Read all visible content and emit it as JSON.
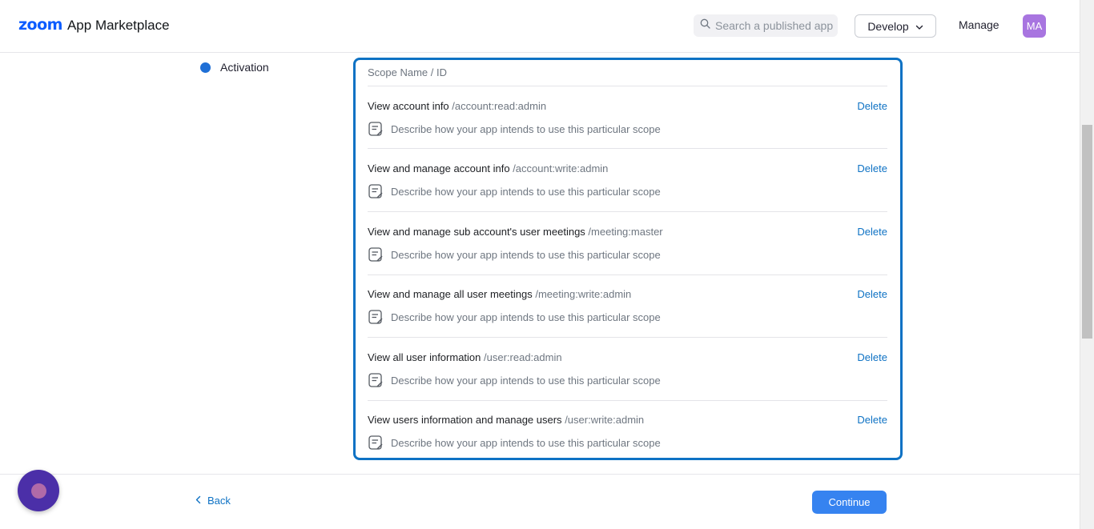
{
  "header": {
    "logo_brand": "zoom",
    "logo_text": "App Marketplace",
    "search_placeholder": "Search a published app",
    "develop_label": "Develop",
    "manage_label": "Manage",
    "avatar_initials": "MA"
  },
  "sidebar": {
    "items": [
      {
        "label": "Activation",
        "color": "#1f6fd6"
      }
    ]
  },
  "scopes": {
    "header": "Scope Name / ID",
    "delete_label": "Delete",
    "description_placeholder": "Describe how your app intends to use this particular scope",
    "items": [
      {
        "name": "View account info",
        "id": "/account:read:admin"
      },
      {
        "name": "View and manage account info",
        "id": "/account:write:admin"
      },
      {
        "name": "View and manage sub account's user meetings",
        "id": "/meeting:master"
      },
      {
        "name": "View and manage all user meetings",
        "id": "/meeting:write:admin"
      },
      {
        "name": "View all user information",
        "id": "/user:read:admin"
      },
      {
        "name": "View users information and manage users",
        "id": "/user:write:admin"
      }
    ]
  },
  "footer": {
    "back_label": "Back",
    "continue_label": "Continue"
  },
  "colors": {
    "accent": "#0e72c4",
    "primary_button": "#3683f0",
    "avatar": "#a875e0",
    "chat_bubble": "#4b2fa8"
  }
}
